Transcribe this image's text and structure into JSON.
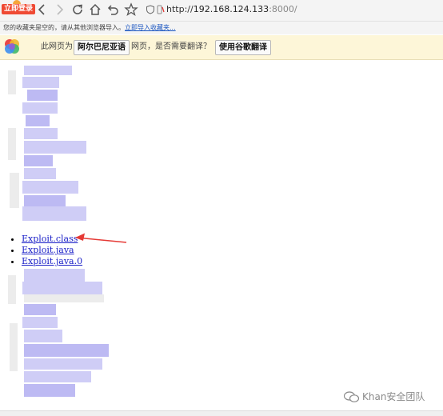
{
  "toolbar": {
    "login_badge": "立即登录",
    "url_scheme": "http://",
    "url_host": "192.168.124.133",
    "url_port": ":8000/"
  },
  "bookmarks_bar": {
    "empty_text": "您的收藏夹是空的，请从其他浏览器导入。",
    "import_link": "立即导入收藏夹..."
  },
  "translate_bar": {
    "prefix": "此网页为",
    "language_button": "阿尔巴尼亚语",
    "question": "网页，是否需要翻译？",
    "translate_button": "使用谷歌翻译"
  },
  "files": [
    {
      "name": "Exploit.class"
    },
    {
      "name": "Exploit.java"
    },
    {
      "name": "Exploit.java.0"
    }
  ],
  "annotation": {
    "arrow_color": "#e53a36"
  },
  "watermark": {
    "text": "Khan安全团队"
  },
  "colors": {
    "link": "#1c21c8",
    "translate_bg": "#fdf6d8",
    "badge": "#ef4a34"
  }
}
